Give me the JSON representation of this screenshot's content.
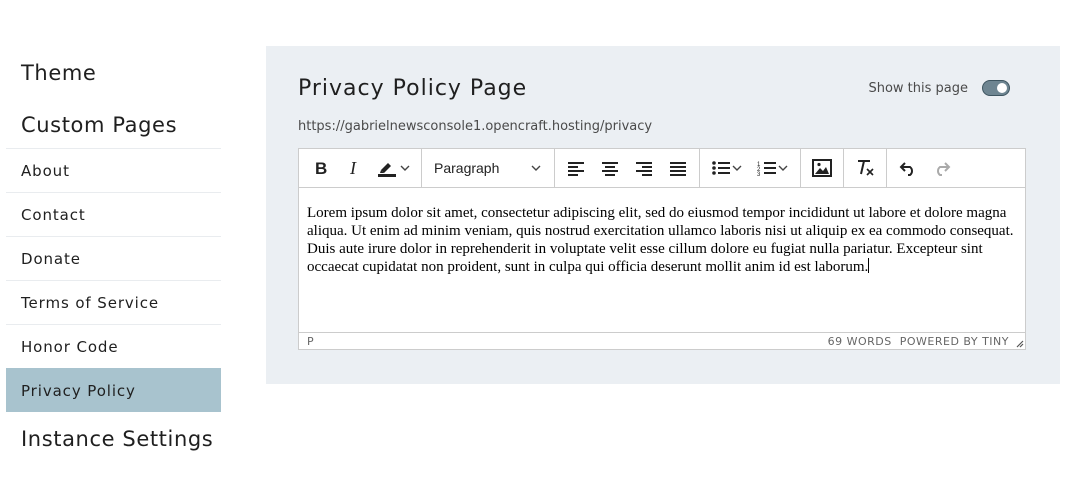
{
  "sidebar": {
    "theme": "Theme",
    "custom_pages": "Custom Pages",
    "items": [
      {
        "label": "About"
      },
      {
        "label": "Contact"
      },
      {
        "label": "Donate"
      },
      {
        "label": "Terms of Service"
      },
      {
        "label": "Honor Code"
      },
      {
        "label": "Privacy Policy",
        "active": true
      }
    ],
    "instance_settings": "Instance Settings"
  },
  "main": {
    "title": "Privacy Policy Page",
    "url": "https://gabrielnewsconsole1.opencraft.hosting/privacy",
    "show_page_label": "Show this page",
    "show_page_enabled": true
  },
  "editor": {
    "block_format": "Paragraph",
    "toolbar_icons": [
      "bold-icon",
      "italic-icon",
      "highlight-icon",
      "align-left-icon",
      "align-center-icon",
      "align-right-icon",
      "align-justify-icon",
      "bullet-list-icon",
      "numbered-list-icon",
      "image-icon",
      "clear-format-icon",
      "undo-icon",
      "redo-icon"
    ],
    "content": "Lorem ipsum dolor sit amet, consectetur adipiscing elit, sed do eiusmod tempor incididunt ut labore et dolore magna aliqua. Ut enim ad minim veniam, quis nostrud exercitation ullamco laboris nisi ut aliquip ex ea commodo consequat. Duis aute irure dolor in reprehenderit in voluptate velit esse cillum dolore eu fugiat nulla pariatur. Excepteur sint occaecat cupidatat non proident, sunt in culpa qui officia deserunt mollit anim id est laborum.",
    "path": "P",
    "word_count": "69 WORDS",
    "powered_by": "POWERED BY TINY"
  },
  "colors": {
    "active_item_bg": "#a8c3ce",
    "panel_bg": "#ebeff3",
    "toggle_on": "#6e8591"
  }
}
